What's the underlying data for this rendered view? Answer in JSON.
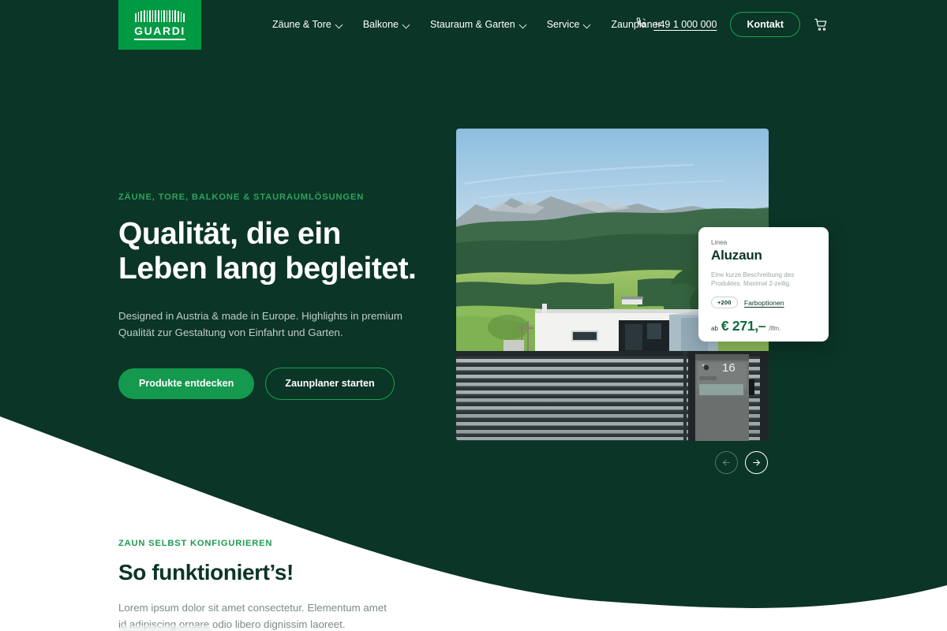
{
  "brand": {
    "name": "GUARDI",
    "accent_green": "#009A43",
    "button_green": "#14994E",
    "dark_green": "#0B3526"
  },
  "header": {
    "nav": [
      {
        "label": "Zäune & Tore",
        "has_dropdown": true
      },
      {
        "label": "Balkone",
        "has_dropdown": true
      },
      {
        "label": "Stauraum & Garten",
        "has_dropdown": true
      },
      {
        "label": "Service",
        "has_dropdown": true
      },
      {
        "label": "Zaunplaner",
        "has_dropdown": false
      }
    ],
    "phone": "+49 1 000 000",
    "phone_icon": "phone-icon",
    "contact_button": "Kontakt",
    "cart_icon": "shopping-cart-icon"
  },
  "hero": {
    "eyebrow": "ZÄUNE, TORE, BALKONE & STAURAUMLÖSUNGEN",
    "headline_line1": "Qualität, die ein",
    "headline_line2": "Leben lang begleitet.",
    "paragraph": "Designed in Austria & made in Europe. Highlights in premium Qualität zur Gestaltung von Einfahrt und Garten.",
    "cta_primary": "Produkte entdecken",
    "cta_secondary": "Zaunplaner starten",
    "image_alt": "Modernes Haus mit Aluminiumzaun vor Bergpanorama",
    "house_number": "16"
  },
  "product_card": {
    "line": "Linea",
    "title": "Aluzaun",
    "description": "Eine kurze Beschreibung des Produktes. Maximal 2-zeilig.",
    "badge": "+200",
    "options_link": "Farboptionen",
    "price_prefix": "ab",
    "price": "€ 271,–",
    "price_unit": "/lfm."
  },
  "carousel": {
    "prev_icon": "arrow-left-icon",
    "next_icon": "arrow-right-icon",
    "prev_enabled": false,
    "next_enabled": true
  },
  "section2": {
    "eyebrow": "ZAUN SELBST KONFIGURIEREN",
    "heading": "So funktioniert’s!",
    "paragraph": "Lorem ipsum dolor sit amet consectetur. Elementum amet id adipiscing ornare odio libero dignissim laoreet."
  }
}
